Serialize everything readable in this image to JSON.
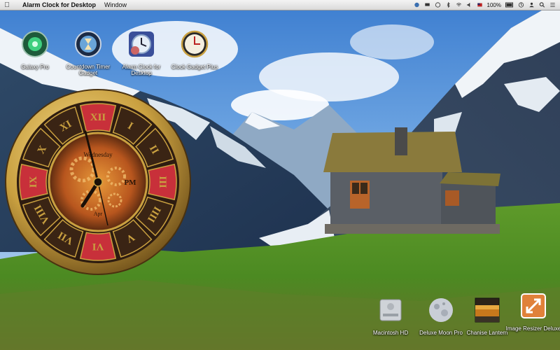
{
  "menubar": {
    "app_name": "Alarm Clock for Desktop",
    "menus": [
      "Window"
    ],
    "battery_text": "100%"
  },
  "desktop_icons_top": [
    {
      "label": "Galaxy Pro",
      "icon": "galaxy-icon"
    },
    {
      "label": "Countdown Timer Gadget",
      "icon": "countdown-timer-icon"
    },
    {
      "label": "Alarm Clock for Desktop",
      "icon": "alarm-clock-icon"
    },
    {
      "label": "Clock Gadget Plus",
      "icon": "clock-gadget-icon"
    }
  ],
  "desktop_icons_bottom": [
    {
      "label": "Macintosh HD",
      "icon": "hard-drive-icon"
    },
    {
      "label": "Deluxe Moon Pro",
      "icon": "moon-icon"
    },
    {
      "label": "Chanise Lantern",
      "icon": "lantern-icon"
    },
    {
      "label": "Image Resizer Deluxe",
      "icon": "image-resizer-icon"
    }
  ],
  "clock": {
    "numerals": [
      "XII",
      "I",
      "II",
      "III",
      "IIII",
      "V",
      "VI",
      "VII",
      "VIII",
      "IX",
      "X",
      "XI"
    ],
    "day_label": "Wednesday",
    "month_label": "Apr",
    "ampm_label": "PM",
    "colors": {
      "gold": "#c9a040",
      "red": "#c8303a",
      "dark": "#3a2414"
    }
  }
}
